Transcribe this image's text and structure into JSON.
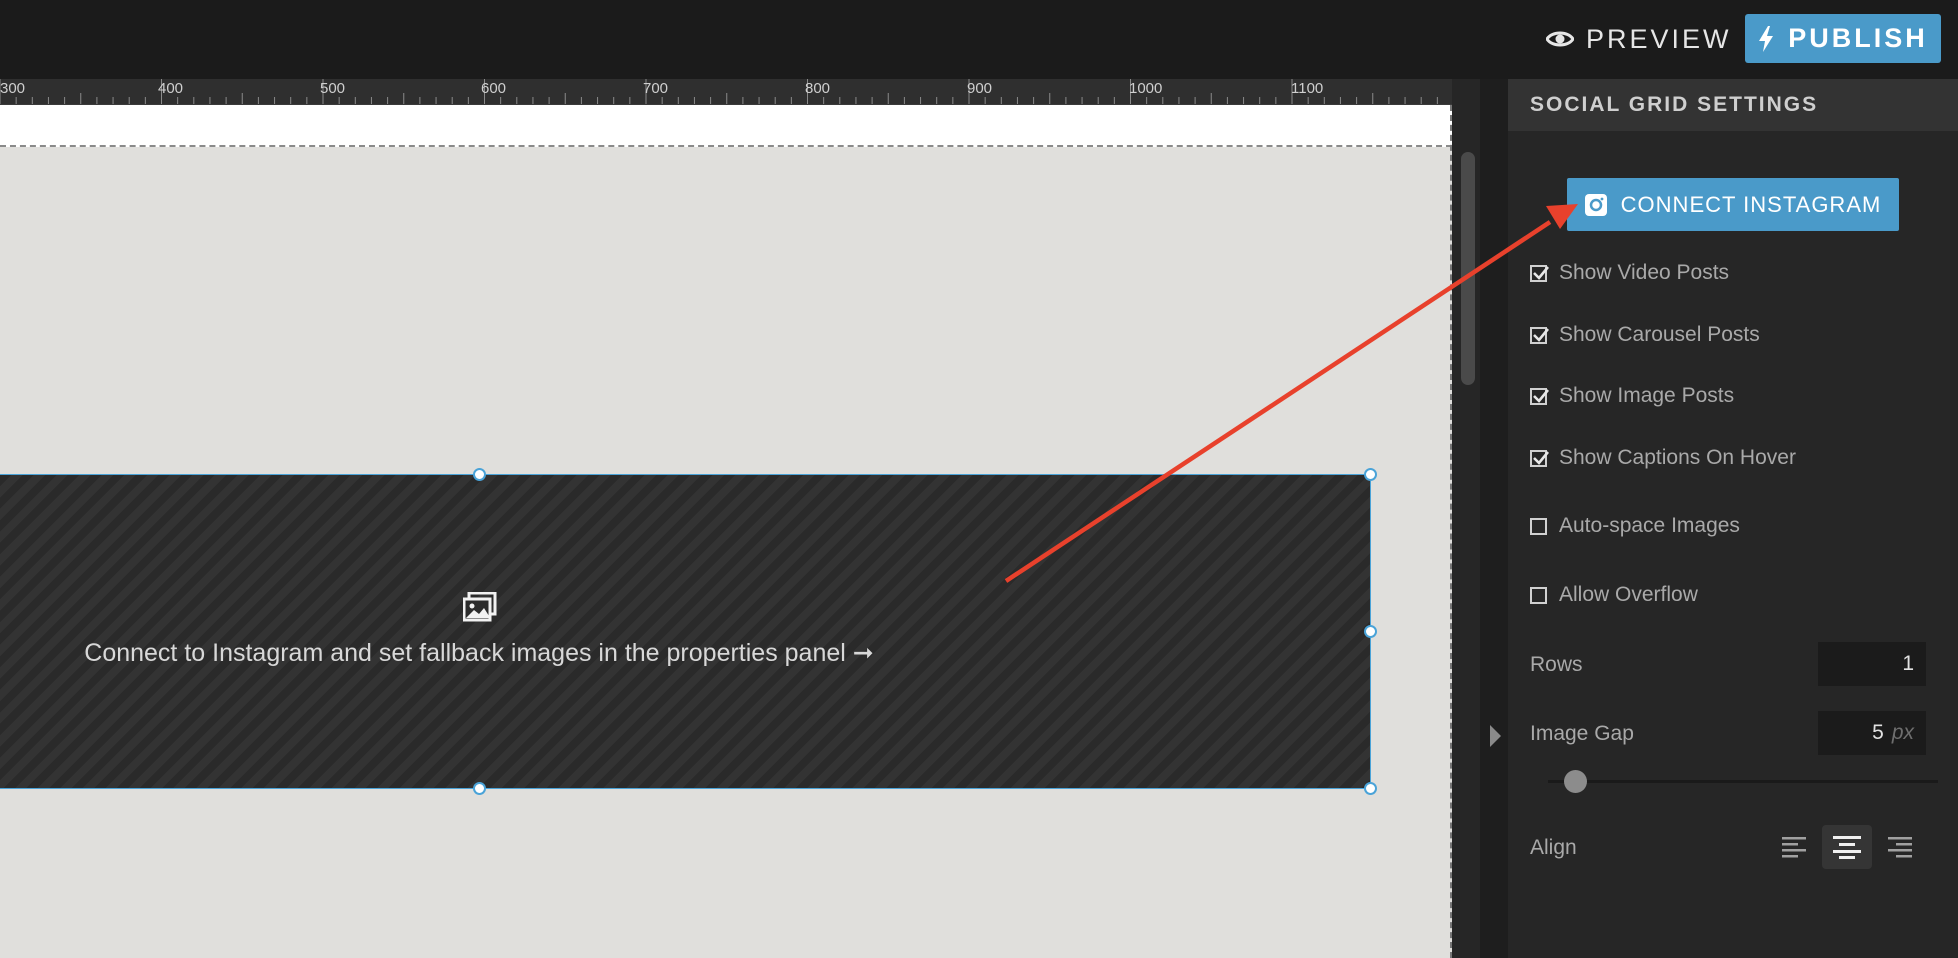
{
  "topbar": {
    "preview_label": "PREVIEW",
    "publish_label": "PUBLISH",
    "accent_color": "#4a9ac9"
  },
  "ruler": {
    "ticks": [
      "300",
      "400",
      "500",
      "600",
      "700",
      "800",
      "900",
      "1000",
      "1100"
    ]
  },
  "canvas": {
    "placeholder_icon": "images-icon",
    "placeholder_text": "Connect to Instagram and set fallback images in the properties panel ➞"
  },
  "panel": {
    "title": "SOCIAL GRID SETTINGS",
    "connect_label": "CONNECT INSTAGRAM",
    "connect_icon": "instagram-icon",
    "options": [
      {
        "label": "Show Video Posts",
        "checked": true
      },
      {
        "label": "Show Carousel Posts",
        "checked": true
      },
      {
        "label": "Show Image Posts",
        "checked": true
      },
      {
        "label": "Show Captions On Hover",
        "checked": true
      },
      {
        "label": "Auto-space Images",
        "checked": false
      },
      {
        "label": "Allow Overflow",
        "checked": false
      }
    ],
    "rows_label": "Rows",
    "rows_value": "1",
    "gap_label": "Image Gap",
    "gap_value": "5",
    "gap_unit": "px",
    "gap_slider_fraction": 0.07,
    "align_label": "Align",
    "align_selected": "center",
    "align_options": [
      "left",
      "center",
      "right"
    ]
  },
  "annotation": {
    "arrow_color": "#e8412c"
  }
}
